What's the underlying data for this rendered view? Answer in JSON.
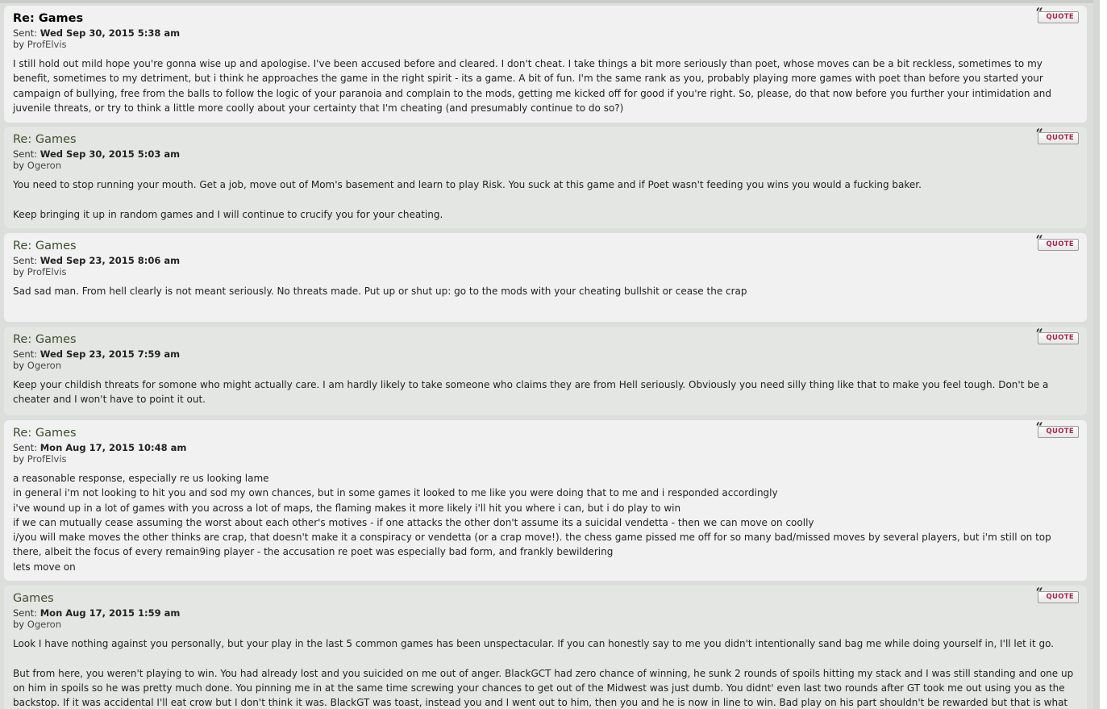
{
  "messages": [
    {
      "subject": "Re: Games",
      "sent_label": "Sent:",
      "date": "Wed Sep 30, 2015 5:38 am",
      "by_label": "by",
      "author": "ProfElvis",
      "quote_label": "QUOTE",
      "lines": [
        "I still hold out mild hope you're gonna wise up and apologise. I've been accused before and cleared. I don't cheat. I take things a bit more seriously than poet, whose moves can be a bit reckless, sometimes to my benefit, sometimes to my detriment, but i think he approaches the game in the right spirit - its a game. A bit of fun. I'm the same rank as you, probably playing more games with poet than before you started your campaign of bullying, free from the balls to follow the logic of your paranoia and complain to the mods, getting me kicked off for good if you're right. So, please, do that now before you further your intimidation and juvenile threats, or try to think a little more coolly about your certainty that I'm cheating (and presumably continue to do so?)"
      ]
    },
    {
      "subject": "Re: Games",
      "sent_label": "Sent:",
      "date": "Wed Sep 30, 2015 5:03 am",
      "by_label": "by",
      "author": "Ogeron",
      "quote_label": "QUOTE",
      "lines": [
        "You need to stop running your mouth. Get a job, move out of Mom's basement and learn to play Risk. You suck at this game and if Poet wasn't feeding you wins you would a fucking baker.",
        "",
        "Keep bringing it up in random games and I will continue to crucify you for your cheating."
      ]
    },
    {
      "subject": "Re: Games",
      "sent_label": "Sent:",
      "date": "Wed Sep 23, 2015 8:06 am",
      "by_label": "by",
      "author": "ProfElvis",
      "quote_label": "QUOTE",
      "lines": [
        "Sad sad man. From hell clearly is not meant seriously. No threats made. Put up or shut up: go to the mods with your cheating bullshit or cease the crap"
      ]
    },
    {
      "subject": "Re: Games",
      "sent_label": "Sent:",
      "date": "Wed Sep 23, 2015 7:59 am",
      "by_label": "by",
      "author": "Ogeron",
      "quote_label": "QUOTE",
      "lines": [
        "Keep your childish threats for somone who might actually care. I am hardly likely to take someone who claims they are from Hell seriously. Obviously you need silly thing like that to make you feel tough. Don't be a cheater and I won't have to point it out."
      ]
    },
    {
      "subject": "Re: Games",
      "sent_label": "Sent:",
      "date": "Mon Aug 17, 2015 10:48 am",
      "by_label": "by",
      "author": "ProfElvis",
      "quote_label": "QUOTE",
      "lines": [
        "a reasonable response, especially re us looking lame",
        "in general i'm not looking to hit you and sod my own chances, but in some games it looked to me like you were doing that to me and i responded accordingly",
        "i've wound up in a lot of games with you across a lot of maps, the flaming makes it more likely i'll hit you where i can, but i do play to win",
        "if we can mutually cease assuming the worst about each other's motives - if one attacks the other don't assume its a suicidal vendetta - then we can move on coolly",
        "i/you will make moves the other thinks are crap, that doesn't make it a conspiracy or vendetta (or a crap move!). the chess game pissed me off for so many bad/missed moves by several players, but i'm still on top there, albeit the focus of every remain9ing player - the accusation re poet was especially bad form, and frankly bewildering",
        "lets move on"
      ]
    },
    {
      "subject": "Games",
      "sent_label": "Sent:",
      "date": "Mon Aug 17, 2015 1:59 am",
      "by_label": "by",
      "author": "Ogeron",
      "quote_label": "QUOTE",
      "lines": [
        "Look I have nothing against you personally, but your play in the last 5 common games has been unspectacular. If you can honestly say to me you didn't intentionally sand bag me while doing yourself in, I'll let it go.",
        "",
        "But from here, you weren't playing to win. You had already lost and you suicided on me out of anger. BlackGCT had zero chance of winning, he sunk 2 rounds of spoils hitting my stack and I was still standing and one up on him in spoils so he was pretty much done. You pinning me in at the same time screwing your chances to get out of the Midwest was just dumb. You didnt' even last two rounds after GT took me out using you as the backstop. If it was accidental I'll eat crow but I don't think it was. BlackGT was toast, instead you and I went out to him, then you and he is now in line to win. Bad play on his part shouldn't be rewarded but that is what happened."
      ]
    }
  ]
}
